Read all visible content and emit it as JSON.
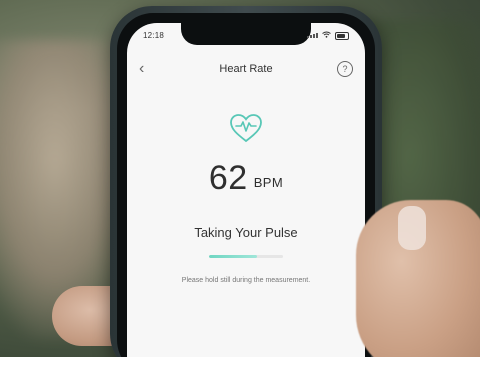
{
  "status_bar": {
    "time": "12:18"
  },
  "nav": {
    "title": "Heart Rate",
    "back_symbol": "‹",
    "help_symbol": "?"
  },
  "measurement": {
    "value": "62",
    "unit": "BPM",
    "status": "Taking Your Pulse",
    "progress_fraction": 0.65,
    "hint": "Please hold still during the measurement."
  },
  "colors": {
    "accent": "#58c7b6",
    "progress": "#70d6c2",
    "text": "#333333"
  },
  "icons": {
    "heart": "heart-pulse-icon",
    "back": "chevron-left-icon",
    "help": "help-circle-icon"
  }
}
